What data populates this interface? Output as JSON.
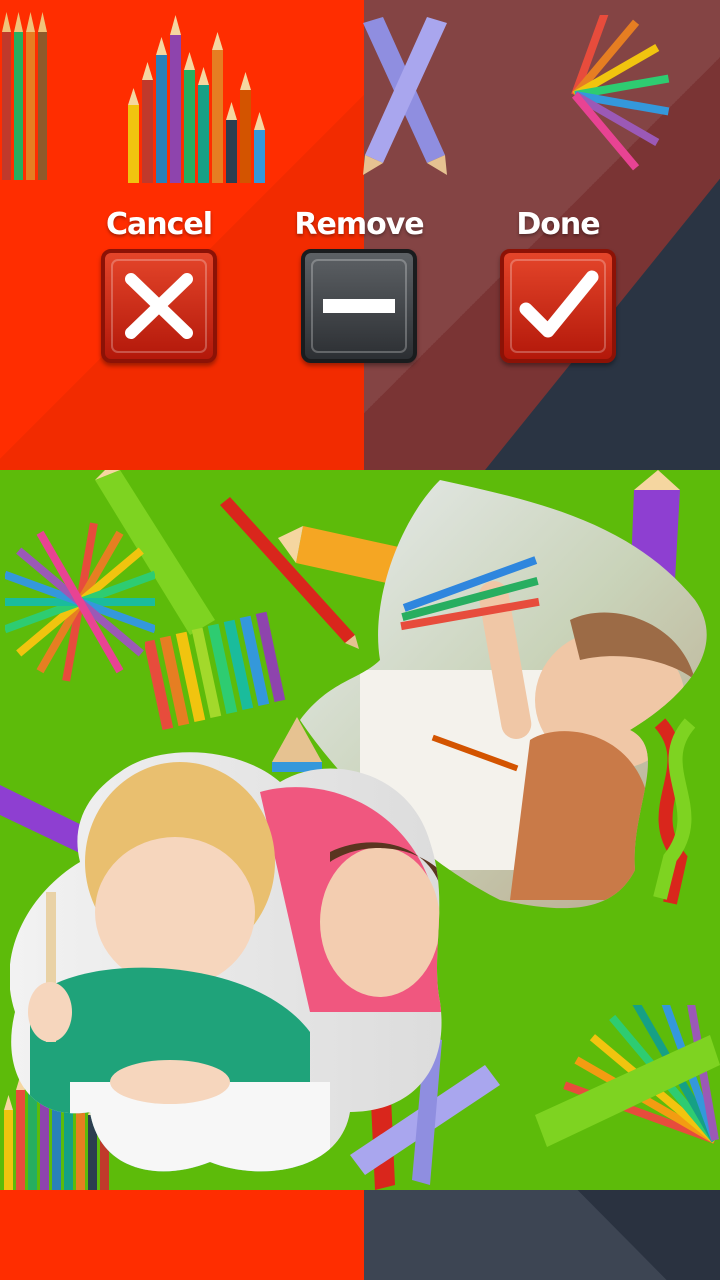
{
  "actions": {
    "cancel": {
      "label": "Cancel"
    },
    "remove": {
      "label": "Remove"
    },
    "done": {
      "label": "Done"
    }
  },
  "colors": {
    "top_left_bg": "#ff2d00",
    "top_right_bg": "#7a3434",
    "dark_panel": "#2a3443",
    "collage_bg": "#5dbb0a",
    "button_red": "#c8240f",
    "button_gray": "#3d4145"
  },
  "collage": {
    "photos": [
      {
        "name": "child-drawing-with-mother",
        "shape": "flower"
      },
      {
        "name": "toddler-holding-pencils",
        "shape": "heart"
      }
    ]
  }
}
